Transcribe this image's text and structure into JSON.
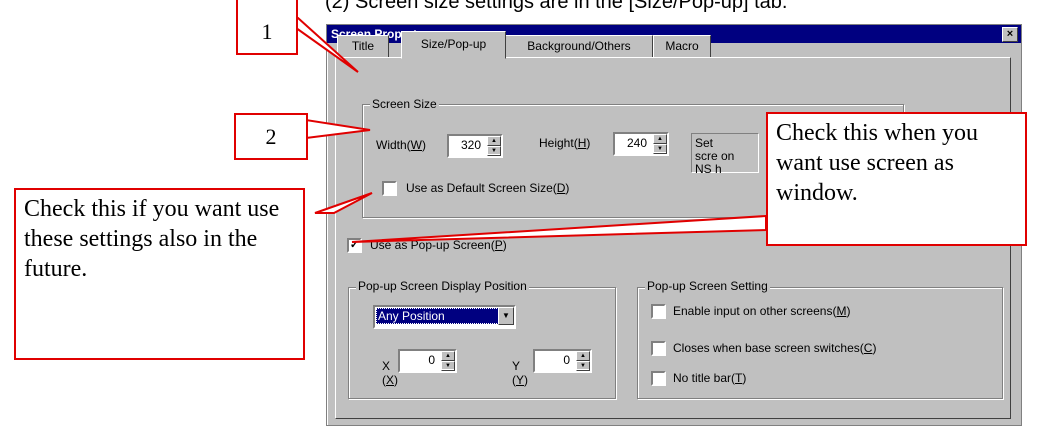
{
  "caption": "(2) Screen size settings are in the [Size/Pop-up] tab.",
  "window": {
    "title": "Screen Property",
    "close_symbol": "×"
  },
  "tabs": [
    {
      "label": "Title",
      "active": false
    },
    {
      "label": "Size/Pop-up",
      "active": true
    },
    {
      "label": "Background/Others",
      "active": false
    },
    {
      "label": "Macro",
      "active": false
    }
  ],
  "screen_size": {
    "group_label": "Screen Size",
    "width_label": "Width(",
    "width_key": "W",
    "width_value": "320",
    "height_label": "Height(",
    "height_key": "H",
    "height_value": "240",
    "default_size_checkbox": {
      "label": "Use as Default Screen Size(",
      "key": "D",
      "checked": false
    },
    "hint_text": "Set scre on NS h"
  },
  "popup_checkbox": {
    "label": "Use as Pop-up Screen(",
    "key": "P",
    "checked": true,
    "mark": "✓"
  },
  "display_position": {
    "group_label": "Pop-up Screen Display Position",
    "selected": "Any Position",
    "x_label": "X",
    "x_key": "X",
    "x_value": "0",
    "y_label": "Y",
    "y_key": "Y",
    "y_value": "0"
  },
  "popup_setting": {
    "group_label": "Pop-up Screen Setting",
    "options": [
      {
        "label": "Enable input on other screens(",
        "key": "M",
        "checked": false
      },
      {
        "label": "Closes when base screen switches(",
        "key": "C",
        "checked": false
      },
      {
        "label": "No title bar(",
        "key": "T",
        "checked": false
      }
    ]
  },
  "callouts": {
    "one": "1",
    "two": "2",
    "popup_note": "Check this when you want use screen as window.",
    "default_note": "Check this if you want use these settings also in the future."
  },
  "colors": {
    "callout_border": "#e00000",
    "titlebar": "#000080",
    "dialog_face": "#c0c0c0"
  }
}
